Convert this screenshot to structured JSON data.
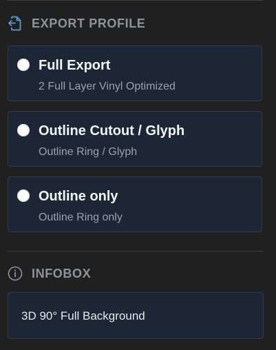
{
  "export_profile": {
    "title": "EXPORT PROFILE",
    "icon": "file-export-icon",
    "icon_color": "#5b9bd5",
    "options": [
      {
        "label": "Full Export",
        "description": "2 Full Layer Vinyl Optimized",
        "selected": false
      },
      {
        "label": "Outline Cutout / Glyph",
        "description": "Outline Ring / Glyph",
        "selected": false
      },
      {
        "label": "Outline only",
        "description": "Outline Ring only",
        "selected": false
      }
    ]
  },
  "infobox": {
    "title": "INFOBOX",
    "icon": "info-circle-icon",
    "value": "3D 90° Full Background"
  },
  "colors": {
    "background": "#202020",
    "card_background": "#1c2634",
    "card_border": "#323b48",
    "header_text": "#8e939b"
  }
}
